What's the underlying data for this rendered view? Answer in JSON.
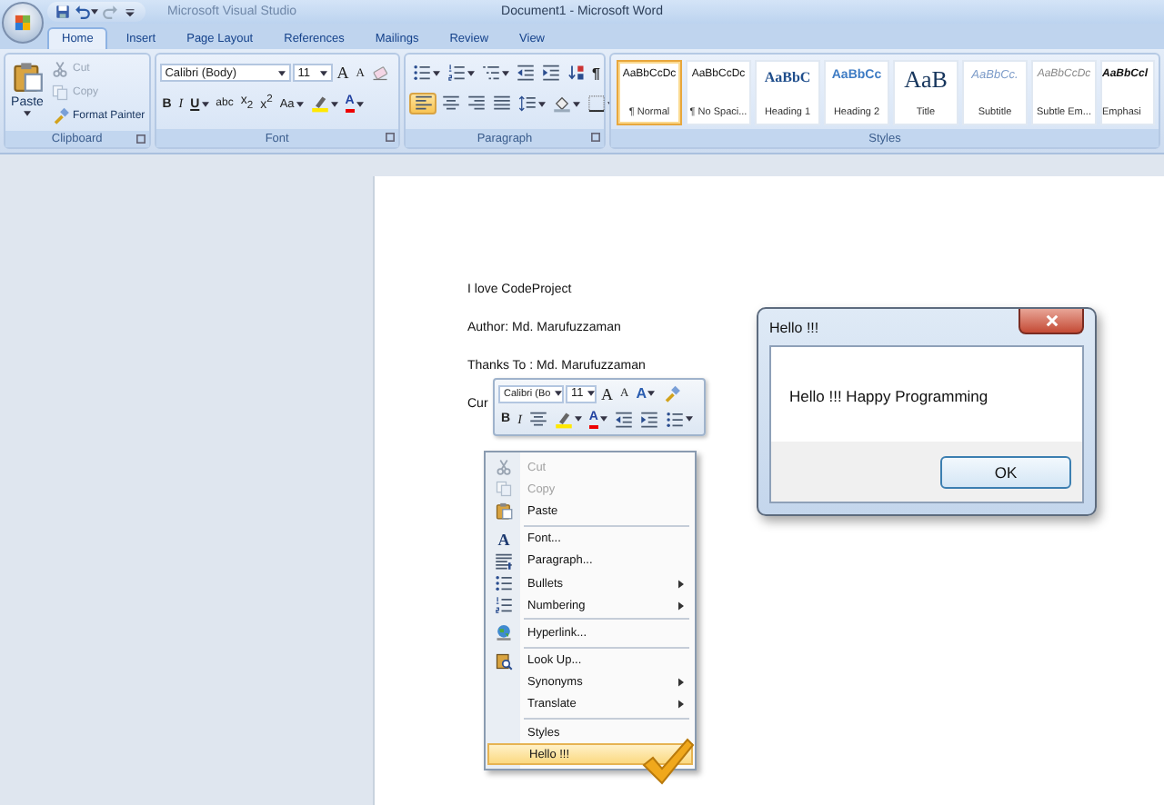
{
  "window": {
    "title": "Document1 - Microsoft Word",
    "faint_title": "Microsoft Visual Studio"
  },
  "quick_access": [
    {
      "kind": "save"
    },
    {
      "kind": "undo",
      "dropdown": true
    },
    {
      "kind": "redo"
    },
    {
      "kind": "customize"
    }
  ],
  "tabs": [
    {
      "label": "Home",
      "selected": true
    },
    {
      "label": "Insert",
      "selected": false
    },
    {
      "label": "Page Layout",
      "selected": false
    },
    {
      "label": "References",
      "selected": false
    },
    {
      "label": "Mailings",
      "selected": false
    },
    {
      "label": "Review",
      "selected": false
    },
    {
      "label": "View",
      "selected": false
    }
  ],
  "clipboard": {
    "label": "Clipboard",
    "paste": "Paste",
    "commands": [
      {
        "label": "Cut",
        "kind": "scissors",
        "disabled": true
      },
      {
        "label": "Copy",
        "kind": "copy",
        "disabled": true
      },
      {
        "label": "Format Painter",
        "kind": "brush",
        "disabled": false
      }
    ]
  },
  "font": {
    "label": "Font",
    "family": "Calibri (Body)",
    "size": "11",
    "row1": [
      {
        "kind": "grow",
        "text": "A"
      },
      {
        "kind": "shrink",
        "text": "A"
      },
      {
        "kind": "clear"
      }
    ],
    "row2": [
      {
        "kind": "bold",
        "text": "B"
      },
      {
        "kind": "italic",
        "text": "I"
      },
      {
        "kind": "underline",
        "text": "U",
        "dropdown": true
      },
      {
        "kind": "strike",
        "text": "abc"
      },
      {
        "kind": "subscript",
        "text": "x$_{2}$"
      },
      {
        "kind": "superscript",
        "text": "x$^{2}$"
      },
      {
        "kind": "case",
        "text": "Aa",
        "dropdown": true
      },
      {
        "kind": "highlight",
        "dropdown": true
      },
      {
        "kind": "color",
        "text": "A",
        "dropdown": true
      }
    ]
  },
  "paragraph": {
    "label": "Paragraph",
    "row1": [
      {
        "kind": "bullets",
        "dropdown": true
      },
      {
        "kind": "numbering",
        "dropdown": true
      },
      {
        "kind": "multilevel",
        "dropdown": true
      },
      {
        "kind": "outdent"
      },
      {
        "kind": "indent"
      },
      {
        "kind": "sort"
      },
      {
        "kind": "pilcrow",
        "text": "¶"
      }
    ],
    "alignment": [
      {
        "kind": "align-left",
        "selected": true
      },
      {
        "kind": "align-center",
        "selected": false
      },
      {
        "kind": "align-right",
        "selected": false
      },
      {
        "kind": "justify",
        "selected": false
      }
    ],
    "row2": [
      {
        "kind": "spacing",
        "dropdown": true
      },
      {
        "kind": "shading",
        "dropdown": true
      },
      {
        "kind": "borders",
        "dropdown": true
      }
    ]
  },
  "styles": {
    "label": "Styles",
    "items": [
      {
        "preview": "AaBbCcDc",
        "label": "¶ Normal",
        "kind": "normal",
        "selected": true
      },
      {
        "preview": "AaBbCcDc",
        "label": "¶ No Spaci...",
        "kind": "normal",
        "selected": false
      },
      {
        "preview": "AaBbC",
        "label": "Heading 1",
        "kind": "heading1",
        "selected": false
      },
      {
        "preview": "AaBbCc",
        "label": "Heading 2",
        "kind": "heading2",
        "selected": false
      },
      {
        "preview": "AaB",
        "label": "Title",
        "kind": "title",
        "selected": false
      },
      {
        "preview": "AaBbCc.",
        "label": "Subtitle",
        "kind": "subtitle",
        "selected": false
      },
      {
        "preview": "AaBbCcDc",
        "label": "Subtle Em...",
        "kind": "subtle",
        "selected": false
      },
      {
        "preview": "AaBbCcl",
        "label": "Emphasi",
        "kind": "emphasis",
        "selected": false
      }
    ]
  },
  "document": {
    "lines": [
      "I love CodeProject",
      "Author: Md. Marufuzzaman",
      "Thanks To : Md. Marufuzzaman",
      "Cur"
    ]
  },
  "mini_toolbar": {
    "family": "Calibri (Bo",
    "size": "11",
    "row1": [
      {
        "kind": "grow",
        "text": "A"
      },
      {
        "kind": "shrink",
        "text": "A"
      },
      {
        "kind": "styles",
        "text": "A",
        "dropdown": true
      },
      {
        "kind": "brush"
      }
    ],
    "row2": [
      {
        "kind": "bold",
        "text": "B"
      },
      {
        "kind": "italic",
        "text": "I"
      },
      {
        "kind": "align-center"
      },
      {
        "kind": "highlight",
        "dropdown": true
      },
      {
        "kind": "color",
        "text": "A",
        "dropdown": true
      },
      {
        "kind": "outdent"
      },
      {
        "kind": "indent"
      },
      {
        "kind": "bullets",
        "dropdown": true
      }
    ]
  },
  "context_menu": [
    {
      "label": "Cut",
      "kind": "scissors",
      "disabled": true,
      "submenu": false,
      "separator_after": false,
      "selected": false
    },
    {
      "label": "Copy",
      "kind": "copy",
      "disabled": true,
      "submenu": false,
      "separator_after": false,
      "selected": false
    },
    {
      "label": "Paste",
      "kind": "paste",
      "disabled": false,
      "submenu": false,
      "separator_after": true,
      "selected": false
    },
    {
      "label": "Font...",
      "kind": "letter",
      "icon_text": "A",
      "disabled": false,
      "submenu": false,
      "separator_after": false,
      "selected": false
    },
    {
      "label": "Paragraph...",
      "kind": "paragraph",
      "disabled": false,
      "submenu": false,
      "separator_after": false,
      "selected": false
    },
    {
      "label": "Bullets",
      "kind": "bullets",
      "disabled": false,
      "submenu": true,
      "separator_after": false,
      "selected": false
    },
    {
      "label": "Numbering",
      "kind": "numbering",
      "disabled": false,
      "submenu": true,
      "separator_after": true,
      "selected": false
    },
    {
      "label": "Hyperlink...",
      "kind": "globe",
      "disabled": false,
      "submenu": false,
      "separator_after": true,
      "selected": false
    },
    {
      "label": "Look Up...",
      "kind": "book",
      "disabled": false,
      "submenu": false,
      "separator_after": false,
      "selected": false
    },
    {
      "label": "Synonyms",
      "kind": "none",
      "disabled": false,
      "submenu": true,
      "separator_after": false,
      "selected": false
    },
    {
      "label": "Translate",
      "kind": "none",
      "disabled": false,
      "submenu": true,
      "separator_after": true,
      "selected": false
    },
    {
      "label": "Styles",
      "kind": "none",
      "disabled": false,
      "submenu": false,
      "separator_after": false,
      "selected": false
    },
    {
      "label": "Hello !!!",
      "kind": "none",
      "disabled": false,
      "submenu": false,
      "separator_after": false,
      "selected": true
    }
  ],
  "dialog": {
    "title": "Hello !!!",
    "message": "Hello !!! Happy Programming",
    "button": "OK"
  }
}
